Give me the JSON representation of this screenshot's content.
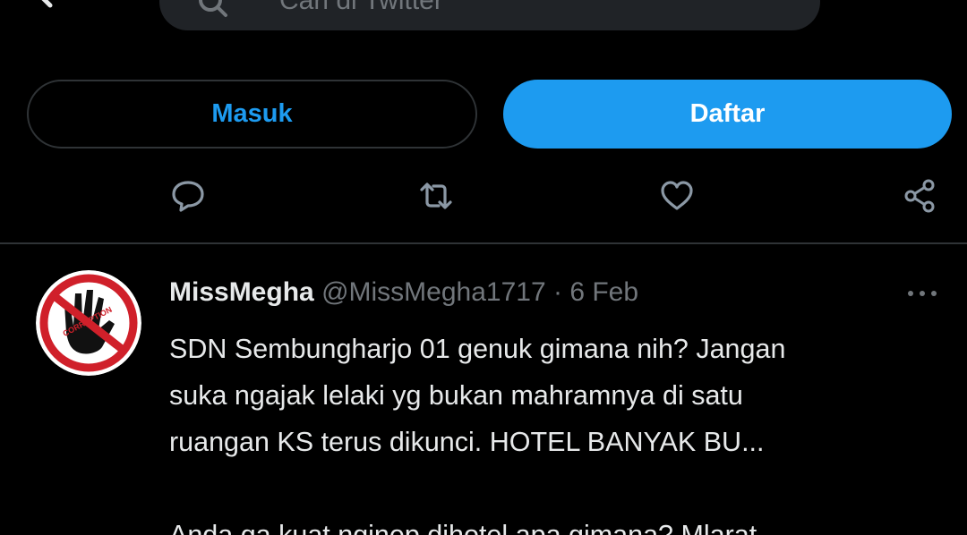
{
  "search": {
    "placeholder": "Cari di Twitter"
  },
  "auth": {
    "login_label": "Masuk",
    "signup_label": "Daftar"
  },
  "icons": {
    "back": "back-arrow-icon",
    "search": "search-icon",
    "more_top": "more-icon",
    "reply": "reply-icon",
    "retweet": "retweet-icon",
    "like": "heart-icon",
    "share": "share-icon",
    "more": "more-icon"
  },
  "tweet": {
    "author_name": "MissMegha",
    "handle": "@MissMegha1717",
    "separator": "·",
    "date": "6 Feb",
    "body_lines": [
      "SDN Sembungharjo 01 genuk gimana nih? Jangan",
      "suka ngajak lelaki yg bukan mahramnya di satu",
      "ruangan KS terus dikunci. HOTEL BANYAK BU...",
      "Anda ga kuat nginep dihotel apa gimana? Mlarat"
    ],
    "avatar_text": "CORRUPTION"
  },
  "colors": {
    "background": "#000000",
    "accent": "#1d9bf0",
    "text": "#e7e9ea",
    "muted": "#71767b",
    "border": "#2f3336"
  }
}
